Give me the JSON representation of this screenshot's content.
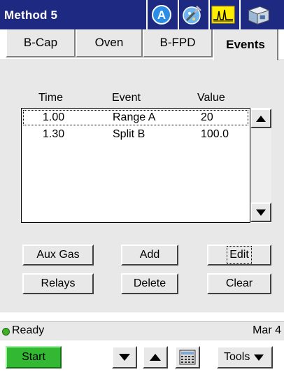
{
  "title": "Method 5",
  "header_icons": [
    "autosampler-icon",
    "tools-wrench-icon",
    "chromatogram-icon",
    "instrument-icon"
  ],
  "tabs": [
    {
      "label": "B-Cap",
      "active": false
    },
    {
      "label": "Oven",
      "active": false
    },
    {
      "label": "B-FPD",
      "active": false
    },
    {
      "label": "Events",
      "active": true
    }
  ],
  "events_table": {
    "columns": [
      "Time",
      "Event",
      "Value"
    ],
    "rows": [
      {
        "time": "1.00",
        "event": "Range A",
        "value": "20",
        "selected": true
      },
      {
        "time": "1.30",
        "event": "Split B",
        "value": "100.0",
        "selected": false
      }
    ]
  },
  "buttons": {
    "aux_gas": "Aux Gas",
    "add": "Add",
    "edit": "Edit",
    "relays": "Relays",
    "delete": "Delete",
    "clear": "Clear"
  },
  "status": {
    "text": "Ready",
    "date": "Mar 4",
    "indicator_color": "#3fae2a"
  },
  "bottom": {
    "start": "Start",
    "tools": "Tools"
  },
  "colors": {
    "title_bar": "#1e2a82",
    "panel": "#e8e8e8",
    "start_button": "#33b833"
  }
}
